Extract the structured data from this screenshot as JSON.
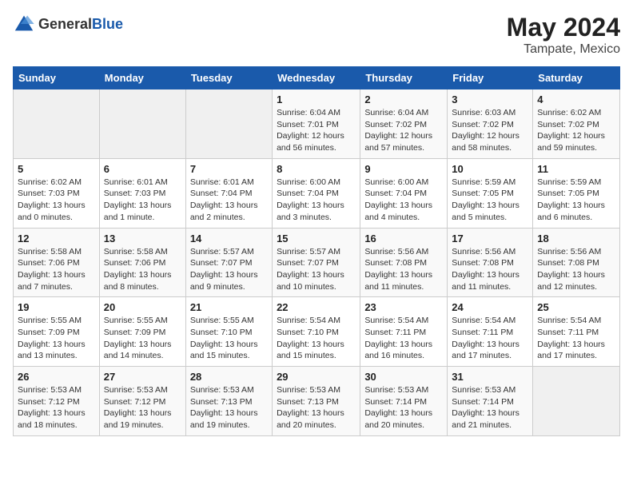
{
  "header": {
    "logo_general": "General",
    "logo_blue": "Blue",
    "title": "May 2024",
    "location": "Tampate, Mexico"
  },
  "days_of_week": [
    "Sunday",
    "Monday",
    "Tuesday",
    "Wednesday",
    "Thursday",
    "Friday",
    "Saturday"
  ],
  "weeks": [
    [
      {
        "day": "",
        "empty": true
      },
      {
        "day": "",
        "empty": true
      },
      {
        "day": "",
        "empty": true
      },
      {
        "day": "1",
        "sunrise": "6:04 AM",
        "sunset": "7:01 PM",
        "daylight": "12 hours and 56 minutes."
      },
      {
        "day": "2",
        "sunrise": "6:04 AM",
        "sunset": "7:02 PM",
        "daylight": "12 hours and 57 minutes."
      },
      {
        "day": "3",
        "sunrise": "6:03 AM",
        "sunset": "7:02 PM",
        "daylight": "12 hours and 58 minutes."
      },
      {
        "day": "4",
        "sunrise": "6:02 AM",
        "sunset": "7:02 PM",
        "daylight": "12 hours and 59 minutes."
      }
    ],
    [
      {
        "day": "5",
        "sunrise": "6:02 AM",
        "sunset": "7:03 PM",
        "daylight": "13 hours and 0 minutes."
      },
      {
        "day": "6",
        "sunrise": "6:01 AM",
        "sunset": "7:03 PM",
        "daylight": "13 hours and 1 minute."
      },
      {
        "day": "7",
        "sunrise": "6:01 AM",
        "sunset": "7:04 PM",
        "daylight": "13 hours and 2 minutes."
      },
      {
        "day": "8",
        "sunrise": "6:00 AM",
        "sunset": "7:04 PM",
        "daylight": "13 hours and 3 minutes."
      },
      {
        "day": "9",
        "sunrise": "6:00 AM",
        "sunset": "7:04 PM",
        "daylight": "13 hours and 4 minutes."
      },
      {
        "day": "10",
        "sunrise": "5:59 AM",
        "sunset": "7:05 PM",
        "daylight": "13 hours and 5 minutes."
      },
      {
        "day": "11",
        "sunrise": "5:59 AM",
        "sunset": "7:05 PM",
        "daylight": "13 hours and 6 minutes."
      }
    ],
    [
      {
        "day": "12",
        "sunrise": "5:58 AM",
        "sunset": "7:06 PM",
        "daylight": "13 hours and 7 minutes."
      },
      {
        "day": "13",
        "sunrise": "5:58 AM",
        "sunset": "7:06 PM",
        "daylight": "13 hours and 8 minutes."
      },
      {
        "day": "14",
        "sunrise": "5:57 AM",
        "sunset": "7:07 PM",
        "daylight": "13 hours and 9 minutes."
      },
      {
        "day": "15",
        "sunrise": "5:57 AM",
        "sunset": "7:07 PM",
        "daylight": "13 hours and 10 minutes."
      },
      {
        "day": "16",
        "sunrise": "5:56 AM",
        "sunset": "7:08 PM",
        "daylight": "13 hours and 11 minutes."
      },
      {
        "day": "17",
        "sunrise": "5:56 AM",
        "sunset": "7:08 PM",
        "daylight": "13 hours and 11 minutes."
      },
      {
        "day": "18",
        "sunrise": "5:56 AM",
        "sunset": "7:08 PM",
        "daylight": "13 hours and 12 minutes."
      }
    ],
    [
      {
        "day": "19",
        "sunrise": "5:55 AM",
        "sunset": "7:09 PM",
        "daylight": "13 hours and 13 minutes."
      },
      {
        "day": "20",
        "sunrise": "5:55 AM",
        "sunset": "7:09 PM",
        "daylight": "13 hours and 14 minutes."
      },
      {
        "day": "21",
        "sunrise": "5:55 AM",
        "sunset": "7:10 PM",
        "daylight": "13 hours and 15 minutes."
      },
      {
        "day": "22",
        "sunrise": "5:54 AM",
        "sunset": "7:10 PM",
        "daylight": "13 hours and 15 minutes."
      },
      {
        "day": "23",
        "sunrise": "5:54 AM",
        "sunset": "7:11 PM",
        "daylight": "13 hours and 16 minutes."
      },
      {
        "day": "24",
        "sunrise": "5:54 AM",
        "sunset": "7:11 PM",
        "daylight": "13 hours and 17 minutes."
      },
      {
        "day": "25",
        "sunrise": "5:54 AM",
        "sunset": "7:11 PM",
        "daylight": "13 hours and 17 minutes."
      }
    ],
    [
      {
        "day": "26",
        "sunrise": "5:53 AM",
        "sunset": "7:12 PM",
        "daylight": "13 hours and 18 minutes."
      },
      {
        "day": "27",
        "sunrise": "5:53 AM",
        "sunset": "7:12 PM",
        "daylight": "13 hours and 19 minutes."
      },
      {
        "day": "28",
        "sunrise": "5:53 AM",
        "sunset": "7:13 PM",
        "daylight": "13 hours and 19 minutes."
      },
      {
        "day": "29",
        "sunrise": "5:53 AM",
        "sunset": "7:13 PM",
        "daylight": "13 hours and 20 minutes."
      },
      {
        "day": "30",
        "sunrise": "5:53 AM",
        "sunset": "7:14 PM",
        "daylight": "13 hours and 20 minutes."
      },
      {
        "day": "31",
        "sunrise": "5:53 AM",
        "sunset": "7:14 PM",
        "daylight": "13 hours and 21 minutes."
      },
      {
        "day": "",
        "empty": true
      }
    ]
  ],
  "labels": {
    "sunrise_label": "Sunrise:",
    "sunset_label": "Sunset:",
    "daylight_label": "Daylight:"
  }
}
